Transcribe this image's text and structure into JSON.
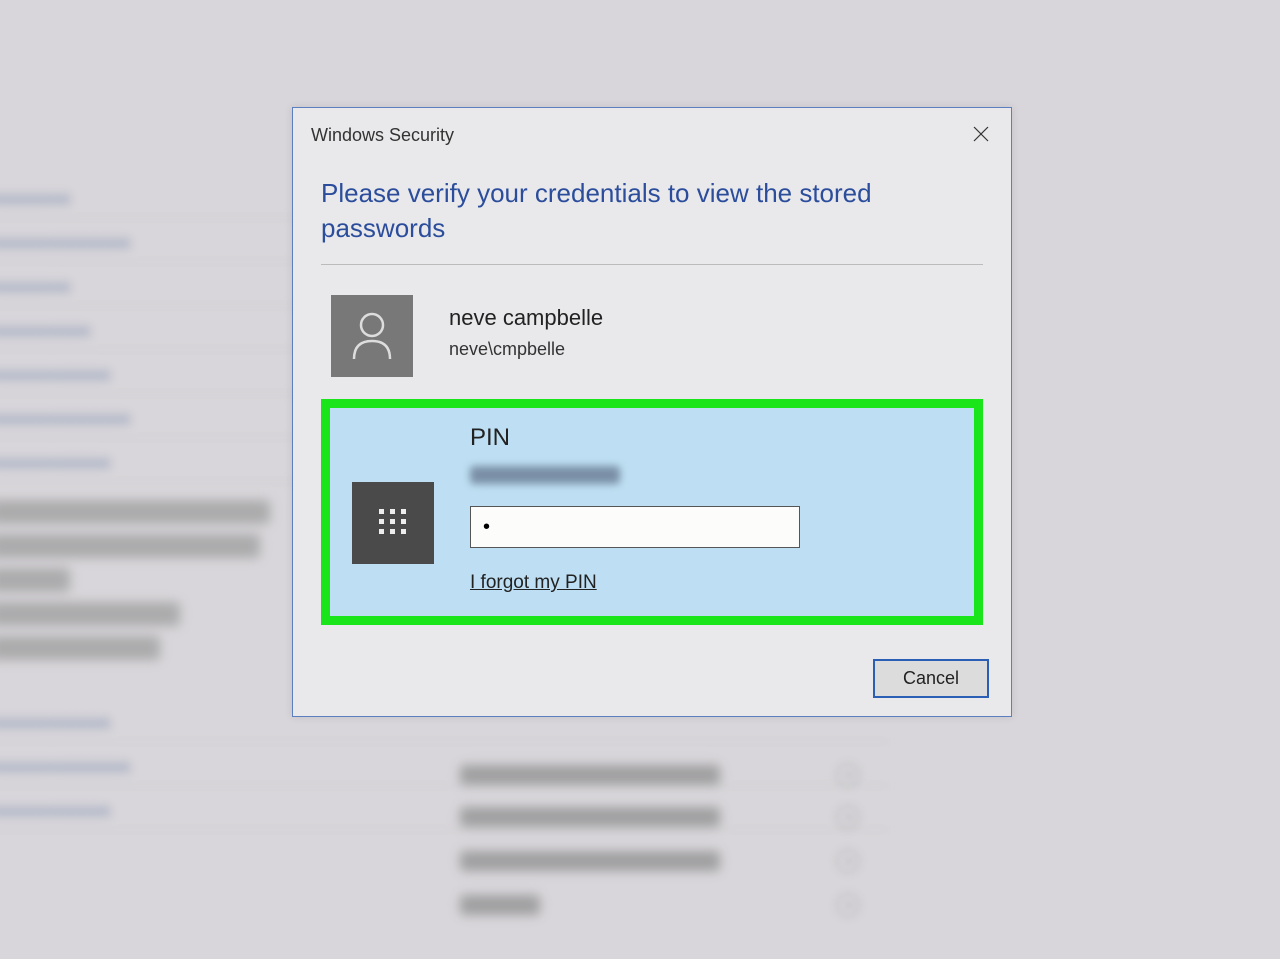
{
  "dialog": {
    "title": "Windows Security",
    "prompt": "Please verify your credentials to view the stored passwords",
    "user": {
      "display_name": "neve campbelle",
      "account": "neve\\cmpbelle"
    },
    "pin": {
      "label": "PIN",
      "value": "•",
      "forgot_link": "I forgot my PIN"
    },
    "cancel": "Cancel"
  },
  "background": {
    "rows": [
      "aptedving.com/",
      "bas.com/",
      "yahoo.com/",
      "doc3d.com/",
      "facebook.com/",
      "facebook.com/"
    ],
    "detail_label": "fa",
    "list_rows": 4,
    "bottom_rows": [
      "facebook.com/",
      "facebook.com/",
      "facebook.com/"
    ]
  }
}
